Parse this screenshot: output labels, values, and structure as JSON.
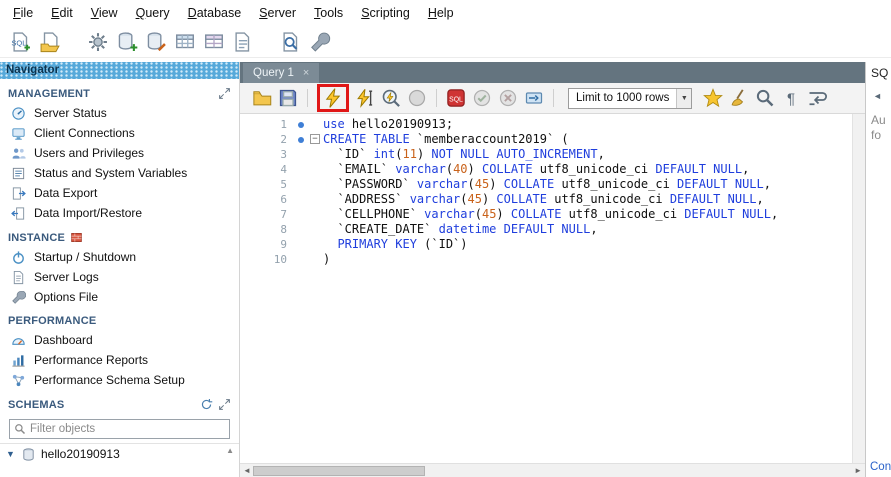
{
  "menubar": {
    "items": [
      "File",
      "Edit",
      "View",
      "Query",
      "Database",
      "Server",
      "Tools",
      "Scripting",
      "Help"
    ]
  },
  "main_toolbar": {
    "icons": [
      "new-query-tab-icon",
      "open-sql-file-icon",
      "connection-options-icon",
      "create-schema-icon",
      "alter-schema-icon",
      "create-table-icon",
      "create-view-icon",
      "create-routine-icon",
      "search-data-icon",
      "server-tools-icon"
    ]
  },
  "navigator": {
    "title": "Navigator",
    "sections": [
      {
        "label": "MANAGEMENT",
        "right_icons": [
          "expand-icon"
        ],
        "items": [
          {
            "label": "Server Status",
            "icon": "server-status-icon"
          },
          {
            "label": "Client Connections",
            "icon": "client-connections-icon"
          },
          {
            "label": "Users and Privileges",
            "icon": "users-icon"
          },
          {
            "label": "Status and System Variables",
            "icon": "system-variables-icon"
          },
          {
            "label": "Data Export",
            "icon": "data-export-icon"
          },
          {
            "label": "Data Import/Restore",
            "icon": "data-import-icon"
          }
        ]
      },
      {
        "label": "INSTANCE",
        "icons_inline": true,
        "right_icons": [
          "firewall-icon"
        ],
        "items": [
          {
            "label": "Startup / Shutdown",
            "icon": "startup-shutdown-icon"
          },
          {
            "label": "Server Logs",
            "icon": "server-logs-icon"
          },
          {
            "label": "Options File",
            "icon": "options-file-icon"
          }
        ]
      },
      {
        "label": "PERFORMANCE",
        "right_icons": [],
        "items": [
          {
            "label": "Dashboard",
            "icon": "dashboard-icon"
          },
          {
            "label": "Performance Reports",
            "icon": "performance-reports-icon"
          },
          {
            "label": "Performance Schema Setup",
            "icon": "performance-schema-icon"
          }
        ]
      },
      {
        "label": "SCHEMAS",
        "right_icons": [
          "refresh-icon",
          "expand-icon"
        ],
        "filter_icon": "search-icon",
        "filter_placeholder": "Filter objects",
        "schemas": [
          {
            "label": "hello20190913",
            "icon": "schema-icon"
          }
        ]
      }
    ]
  },
  "editor": {
    "tab_label": "Query 1",
    "toolbar": {
      "limit_label": "Limit to 1000 rows",
      "items": [
        {
          "type": "icon",
          "name": "open-file-icon"
        },
        {
          "type": "icon",
          "name": "save-icon"
        },
        {
          "type": "sep"
        },
        {
          "type": "icon",
          "name": "execute-icon",
          "highlight": true
        },
        {
          "type": "icon",
          "name": "execute-current-icon"
        },
        {
          "type": "icon",
          "name": "explain-icon"
        },
        {
          "type": "icon",
          "name": "stop-icon"
        },
        {
          "type": "sep"
        },
        {
          "type": "icon",
          "name": "stop-on-error-icon"
        },
        {
          "type": "icon",
          "name": "commit-icon"
        },
        {
          "type": "icon",
          "name": "rollback-icon"
        },
        {
          "type": "icon",
          "name": "autocommit-icon"
        },
        {
          "type": "sep"
        },
        {
          "type": "dropdown"
        },
        {
          "type": "icon",
          "name": "save-snippet-icon"
        },
        {
          "type": "icon",
          "name": "beautify-icon"
        },
        {
          "type": "icon",
          "name": "find-icon"
        },
        {
          "type": "icon",
          "name": "invisibles-icon"
        },
        {
          "type": "icon",
          "name": "wrap-text-icon"
        }
      ]
    },
    "code": {
      "lines": [
        {
          "n": "1",
          "marker": "dot",
          "tokens": [
            [
              "kw",
              "use"
            ],
            [
              "pl",
              " hello20190913;"
            ]
          ]
        },
        {
          "n": "2",
          "marker": "dot",
          "fold": "minus",
          "tokens": [
            [
              "kw",
              "CREATE TABLE"
            ],
            [
              "pl",
              " `memberaccount2019` ("
            ]
          ]
        },
        {
          "n": "3",
          "tokens": [
            [
              "pl",
              "  `ID` "
            ],
            [
              "kw",
              "int"
            ],
            [
              "pl",
              "("
            ],
            [
              "num",
              "11"
            ],
            [
              "pl",
              ") "
            ],
            [
              "kw",
              "NOT NULL AUTO_INCREMENT"
            ],
            [
              "pl",
              ","
            ]
          ]
        },
        {
          "n": "4",
          "tokens": [
            [
              "pl",
              "  `EMAIL` "
            ],
            [
              "kw",
              "varchar"
            ],
            [
              "pl",
              "("
            ],
            [
              "num",
              "40"
            ],
            [
              "pl",
              ") "
            ],
            [
              "kw",
              "COLLATE"
            ],
            [
              "pl",
              " utf8_unicode_ci "
            ],
            [
              "kw",
              "DEFAULT NULL"
            ],
            [
              "pl",
              ","
            ]
          ]
        },
        {
          "n": "5",
          "tokens": [
            [
              "pl",
              "  `PASSWORD` "
            ],
            [
              "kw",
              "varchar"
            ],
            [
              "pl",
              "("
            ],
            [
              "num",
              "45"
            ],
            [
              "pl",
              ") "
            ],
            [
              "kw",
              "COLLATE"
            ],
            [
              "pl",
              " utf8_unicode_ci "
            ],
            [
              "kw",
              "DEFAULT NULL"
            ],
            [
              "pl",
              ","
            ]
          ]
        },
        {
          "n": "6",
          "tokens": [
            [
              "pl",
              "  `ADDRESS` "
            ],
            [
              "kw",
              "varchar"
            ],
            [
              "pl",
              "("
            ],
            [
              "num",
              "45"
            ],
            [
              "pl",
              ") "
            ],
            [
              "kw",
              "COLLATE"
            ],
            [
              "pl",
              " utf8_unicode_ci "
            ],
            [
              "kw",
              "DEFAULT NULL"
            ],
            [
              "pl",
              ","
            ]
          ]
        },
        {
          "n": "7",
          "tokens": [
            [
              "pl",
              "  `CELLPHONE` "
            ],
            [
              "kw",
              "varchar"
            ],
            [
              "pl",
              "("
            ],
            [
              "num",
              "45"
            ],
            [
              "pl",
              ") "
            ],
            [
              "kw",
              "COLLATE"
            ],
            [
              "pl",
              " utf8_unicode_ci "
            ],
            [
              "kw",
              "DEFAULT NULL"
            ],
            [
              "pl",
              ","
            ]
          ]
        },
        {
          "n": "8",
          "tokens": [
            [
              "pl",
              "  `CREATE_DATE` "
            ],
            [
              "kw",
              "datetime"
            ],
            [
              "pl",
              " "
            ],
            [
              "kw",
              "DEFAULT NULL"
            ],
            [
              "pl",
              ","
            ]
          ]
        },
        {
          "n": "9",
          "tokens": [
            [
              "pl",
              "  "
            ],
            [
              "kw",
              "PRIMARY KEY"
            ],
            [
              "pl",
              " (`ID`)"
            ]
          ]
        },
        {
          "n": "10",
          "tokens": [
            [
              "pl",
              ")"
            ]
          ]
        }
      ]
    }
  },
  "right_panel": {
    "header": "SQ",
    "text_line1": "Au",
    "text_line2": "fo",
    "bottom_tab": "Con"
  },
  "colors": {
    "highlight_box": "#e01717",
    "keyword": "#1f3edd",
    "number": "#c9621a",
    "navigator_header": "#56a9da"
  }
}
